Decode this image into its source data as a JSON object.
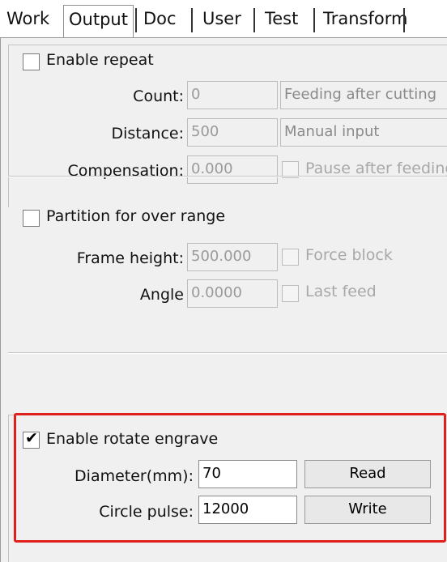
{
  "tabs": [
    {
      "label": "Work"
    },
    {
      "label": "Output",
      "active": true
    },
    {
      "label": "Doc"
    },
    {
      "label": "User"
    },
    {
      "label": "Test"
    },
    {
      "label": "Transform"
    }
  ],
  "repeat": {
    "enable_label": "Enable repeat",
    "enabled": false,
    "count_label": "Count:",
    "count_value": "0",
    "count_mode": "Feeding after cutting",
    "distance_label": "Distance:",
    "distance_value": "500",
    "distance_mode": "Manual input",
    "compensation_label": "Compensation:",
    "compensation_value": "0.000",
    "pause_label": "Pause after feeding",
    "pause_checked": false
  },
  "partition": {
    "enable_label": "Partition for over range",
    "enabled": false,
    "frame_height_label": "Frame height:",
    "frame_height_value": "500.000",
    "force_block_label": "Force block",
    "force_block_checked": false,
    "angle_label": "Angle",
    "angle_value": "0.0000",
    "last_feed_label": "Last feed",
    "last_feed_checked": false
  },
  "rotate": {
    "enable_label": "Enable rotate engrave",
    "enabled": true,
    "diameter_label": "Diameter(mm):",
    "diameter_value": "70",
    "read_button": "Read",
    "circle_pulse_label": "Circle pulse:",
    "circle_pulse_value": "12000",
    "write_button": "Write"
  },
  "highlight_color": "#e0201c"
}
